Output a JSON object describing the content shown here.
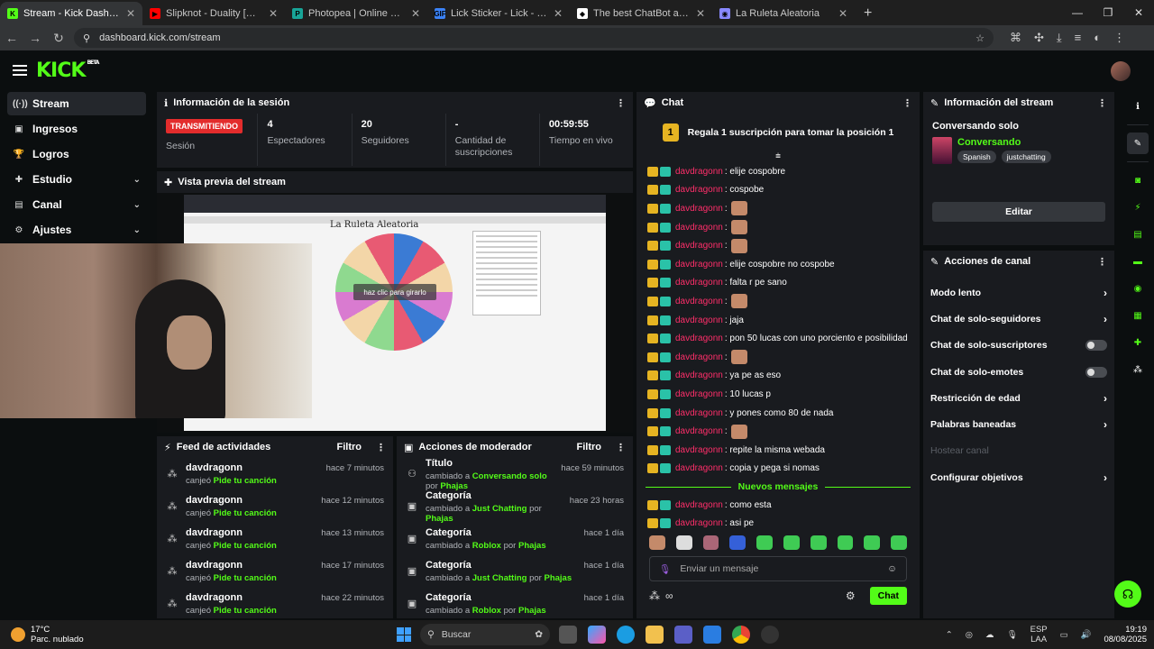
{
  "browser": {
    "tabs": [
      {
        "label": "Stream - Kick Dashboard",
        "color": "#53fc18",
        "glyph": "K",
        "active": true
      },
      {
        "label": "Slipknot - Duality [OFFICIAL VIDEO]",
        "color": "#ff0000",
        "glyph": "▶",
        "active": false
      },
      {
        "label": "Photopea | Online Photo Editor",
        "color": "#18a497",
        "glyph": "P",
        "active": false
      },
      {
        "label": "Lick Sticker - Lick - Descubrir y compartir",
        "color": "#3b82f6",
        "glyph": "GIF",
        "active": false
      },
      {
        "label": "The best ChatBot and Widgets for Kick",
        "color": "#ffffff",
        "glyph": "◆",
        "active": false
      },
      {
        "label": "La Ruleta Aleatoria",
        "color": "#8888ff",
        "glyph": "◉",
        "active": false
      }
    ],
    "url": "dashboard.kick.com/stream"
  },
  "header": {
    "logo": "KICK",
    "beta": "BETA"
  },
  "sidebar": {
    "items": [
      {
        "label": "Stream",
        "icon": "broadcast-icon",
        "glyph": "((·))",
        "chevron": false,
        "active": true
      },
      {
        "label": "Ingresos",
        "icon": "dollar-icon",
        "glyph": "▣",
        "chevron": false,
        "active": false
      },
      {
        "label": "Logros",
        "icon": "trophy-icon",
        "glyph": "🏆",
        "chevron": false,
        "active": false
      },
      {
        "label": "Estudio",
        "icon": "studio-icon",
        "glyph": "✚",
        "chevron": true,
        "active": false
      },
      {
        "label": "Canal",
        "icon": "channel-icon",
        "glyph": "▤",
        "chevron": true,
        "active": false
      },
      {
        "label": "Ajustes",
        "icon": "gear-icon",
        "glyph": "⚙",
        "chevron": true,
        "active": false
      }
    ]
  },
  "session": {
    "title": "Información de la sesión",
    "live_badge": "TRANSMITIENDO",
    "session_label": "Sesión",
    "stats": [
      {
        "value": "4",
        "label": "Espectadores"
      },
      {
        "value": "20",
        "label": "Seguidores"
      },
      {
        "value": "-",
        "label": "Cantidad de suscripciones"
      },
      {
        "value": "00:59:55",
        "label": "Tiempo en vivo"
      }
    ]
  },
  "preview": {
    "title": "Vista previa del stream",
    "screen_title": "La Ruleta Aleatoria",
    "wheel_button": "haz clic para girarlo"
  },
  "feed": {
    "title": "Feed de actividades",
    "filter": "Filtro",
    "items": [
      {
        "user": "davdragonn",
        "action": "canjeó",
        "reward": "Pide tu canción",
        "time": "hace 7 minutos"
      },
      {
        "user": "davdragonn",
        "action": "canjeó",
        "reward": "Pide tu canción",
        "time": "hace 12 minutos"
      },
      {
        "user": "davdragonn",
        "action": "canjeó",
        "reward": "Pide tu canción",
        "time": "hace 13 minutos"
      },
      {
        "user": "davdragonn",
        "action": "canjeó",
        "reward": "Pide tu canción",
        "time": "hace 17 minutos"
      },
      {
        "user": "davdragonn",
        "action": "canjeó",
        "reward": "Pide tu canción",
        "time": "hace 22 minutos"
      }
    ]
  },
  "modactions": {
    "title": "Acciones de moderador",
    "filter": "Filtro",
    "items": [
      {
        "field": "Título",
        "changed": "cambiado a",
        "value": "Conversando solo",
        "by": "por",
        "mod": "Phajas",
        "time": "hace 59 minutos"
      },
      {
        "field": "Categoría",
        "changed": "cambiado a",
        "value": "Just Chatting",
        "by": "por",
        "mod": "Phajas",
        "time": "hace 23 horas"
      },
      {
        "field": "Categoría",
        "changed": "cambiado a",
        "value": "Roblox",
        "by": "por",
        "mod": "Phajas",
        "time": "hace 1 día"
      },
      {
        "field": "Categoría",
        "changed": "cambiado a",
        "value": "Just Chatting",
        "by": "por",
        "mod": "Phajas",
        "time": "hace 1 día"
      },
      {
        "field": "Categoría",
        "changed": "cambiado a",
        "value": "Roblox",
        "by": "por",
        "mod": "Phajas",
        "time": "hace 1 día"
      }
    ]
  },
  "chat": {
    "title": "Chat",
    "pinned_rank": "1",
    "pinned_text": "Regala 1 suscripción para tomar la posición 1",
    "messages": [
      {
        "user": "davdragonn",
        "text": ": elije cospobre",
        "emote": false
      },
      {
        "user": "davdragonn",
        "text": ": cospobe",
        "emote": false
      },
      {
        "user": "davdragonn",
        "text": ":",
        "emote": true
      },
      {
        "user": "davdragonn",
        "text": ":",
        "emote": true
      },
      {
        "user": "davdragonn",
        "text": ":",
        "emote": true
      },
      {
        "user": "davdragonn",
        "text": ": elije cospobre no cospobe",
        "emote": false
      },
      {
        "user": "davdragonn",
        "text": ": falta r pe sano",
        "emote": false
      },
      {
        "user": "davdragonn",
        "text": ":",
        "emote": true
      },
      {
        "user": "davdragonn",
        "text": ": jaja",
        "emote": false
      },
      {
        "user": "davdragonn",
        "text": ": pon 50 lucas con uno porciento e posibilidad",
        "emote": false
      },
      {
        "user": "davdragonn",
        "text": ":",
        "emote": true
      },
      {
        "user": "davdragonn",
        "text": ": ya pe as eso",
        "emote": false
      },
      {
        "user": "davdragonn",
        "text": ": 10 lucas p",
        "emote": false
      },
      {
        "user": "davdragonn",
        "text": ": y pones como 80 de nada",
        "emote": false
      },
      {
        "user": "davdragonn",
        "text": ":",
        "emote": true
      },
      {
        "user": "davdragonn",
        "text": ": repite la misma webada",
        "emote": false
      },
      {
        "user": "davdragonn",
        "text": ": copia y pega si nomas",
        "emote": false
      }
    ],
    "new_label": "Nuevos mensajes",
    "new_messages": [
      {
        "user": "davdragonn",
        "text": ": como esta",
        "emote": false
      },
      {
        "user": "davdragonn",
        "text": ": asi pe",
        "emote": false
      }
    ],
    "input_placeholder": "Enviar un mensaje",
    "send_label": "Chat"
  },
  "streaminfo": {
    "title": "Información del stream",
    "stream_title": "Conversando solo",
    "category": "Conversando",
    "tags": [
      "Spanish",
      "justchatting"
    ],
    "edit_label": "Editar"
  },
  "channel_actions": {
    "title": "Acciones de canal",
    "items": [
      {
        "label": "Modo lento",
        "kind": "arrow"
      },
      {
        "label": "Chat de solo-seguidores",
        "kind": "arrow"
      },
      {
        "label": "Chat de solo-suscriptores",
        "kind": "toggle"
      },
      {
        "label": "Chat de solo-emotes",
        "kind": "toggle"
      },
      {
        "label": "Restricción de edad",
        "kind": "arrow"
      },
      {
        "label": "Palabras baneadas",
        "kind": "arrow"
      },
      {
        "label": "Hostear canal",
        "kind": "disabled"
      },
      {
        "label": "Configurar objetivos",
        "kind": "arrow"
      }
    ]
  },
  "taskbar": {
    "temp": "17°C",
    "weather": "Parc. nublado",
    "search": "Buscar",
    "lang1": "ESP",
    "lang2": "LAA",
    "time": "19:19",
    "date": "08/08/2025"
  }
}
